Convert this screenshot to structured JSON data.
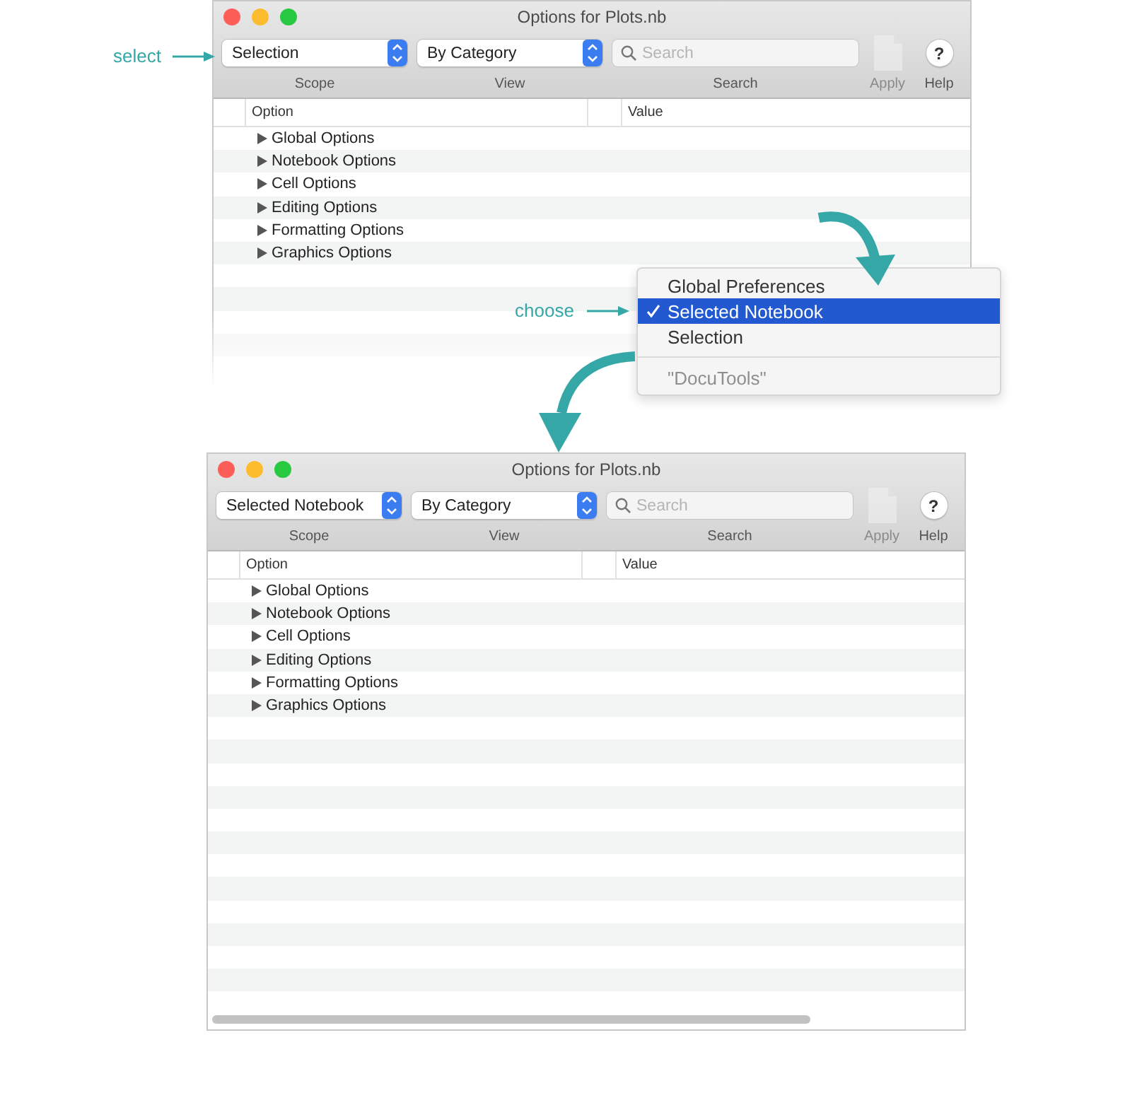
{
  "annotations": {
    "select": "select",
    "choose": "choose"
  },
  "windows": [
    {
      "title": "Options for Plots.nb",
      "scope": "Selection",
      "view": "By Category",
      "search_placeholder": "Search",
      "labels": {
        "scope": "Scope",
        "view": "View",
        "search": "Search",
        "apply": "Apply",
        "help": "Help"
      },
      "apply_disabled": true,
      "help_icon": "?",
      "columns": [
        "Option",
        "Value"
      ],
      "rows": [
        {
          "label": "Global Options",
          "expanded": false
        },
        {
          "label": "Notebook Options",
          "expanded": false
        },
        {
          "label": "Cell Options",
          "expanded": false
        },
        {
          "label": "Editing Options",
          "expanded": false
        },
        {
          "label": "Formatting Options",
          "expanded": false
        },
        {
          "label": "Graphics Options",
          "expanded": false
        }
      ]
    },
    {
      "title": "Options for Plots.nb",
      "scope": "Selected Notebook",
      "view": "By Category",
      "search_placeholder": "Search",
      "labels": {
        "scope": "Scope",
        "view": "View",
        "search": "Search",
        "apply": "Apply",
        "help": "Help"
      },
      "apply_disabled": true,
      "help_icon": "?",
      "columns": [
        "Option",
        "Value"
      ],
      "rows": [
        {
          "label": "Global Options",
          "expanded": false
        },
        {
          "label": "Notebook Options",
          "expanded": false
        },
        {
          "label": "Cell Options",
          "expanded": false
        },
        {
          "label": "Editing Options",
          "expanded": false
        },
        {
          "label": "Formatting Options",
          "expanded": false
        },
        {
          "label": "Graphics Options",
          "expanded": false
        }
      ]
    }
  ],
  "popup_menu": {
    "items": [
      {
        "kind": "item",
        "label": "Global Preferences",
        "selected": false,
        "disabled": false
      },
      {
        "kind": "item",
        "label": "Selected Notebook",
        "selected": true,
        "disabled": false
      },
      {
        "kind": "item",
        "label": "Selection",
        "selected": false,
        "disabled": false
      },
      {
        "kind": "separator"
      },
      {
        "kind": "item",
        "label": "\"DocuTools\"",
        "selected": false,
        "disabled": true
      }
    ]
  }
}
